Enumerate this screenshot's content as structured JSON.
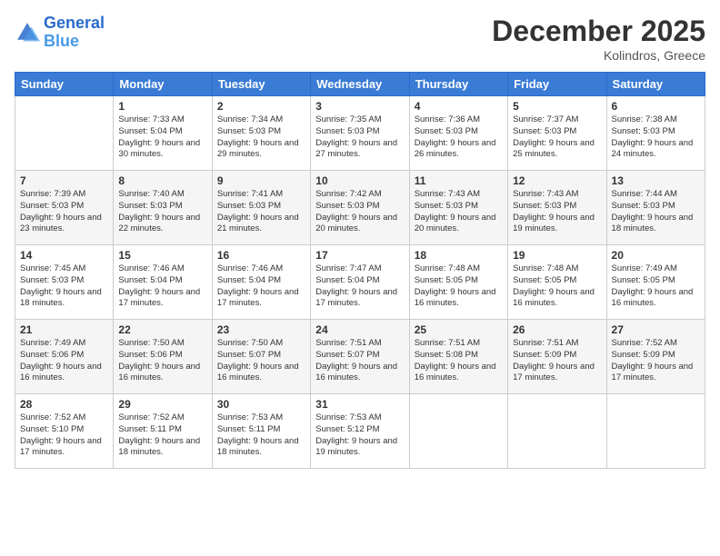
{
  "header": {
    "logo_line1": "General",
    "logo_line2": "Blue",
    "month_title": "December 2025",
    "subtitle": "Kolindros, Greece"
  },
  "weekdays": [
    "Sunday",
    "Monday",
    "Tuesday",
    "Wednesday",
    "Thursday",
    "Friday",
    "Saturday"
  ],
  "weeks": [
    [
      {
        "day": "",
        "sunrise": "",
        "sunset": "",
        "daylight": ""
      },
      {
        "day": "1",
        "sunrise": "Sunrise: 7:33 AM",
        "sunset": "Sunset: 5:04 PM",
        "daylight": "Daylight: 9 hours and 30 minutes."
      },
      {
        "day": "2",
        "sunrise": "Sunrise: 7:34 AM",
        "sunset": "Sunset: 5:03 PM",
        "daylight": "Daylight: 9 hours and 29 minutes."
      },
      {
        "day": "3",
        "sunrise": "Sunrise: 7:35 AM",
        "sunset": "Sunset: 5:03 PM",
        "daylight": "Daylight: 9 hours and 27 minutes."
      },
      {
        "day": "4",
        "sunrise": "Sunrise: 7:36 AM",
        "sunset": "Sunset: 5:03 PM",
        "daylight": "Daylight: 9 hours and 26 minutes."
      },
      {
        "day": "5",
        "sunrise": "Sunrise: 7:37 AM",
        "sunset": "Sunset: 5:03 PM",
        "daylight": "Daylight: 9 hours and 25 minutes."
      },
      {
        "day": "6",
        "sunrise": "Sunrise: 7:38 AM",
        "sunset": "Sunset: 5:03 PM",
        "daylight": "Daylight: 9 hours and 24 minutes."
      }
    ],
    [
      {
        "day": "7",
        "sunrise": "Sunrise: 7:39 AM",
        "sunset": "Sunset: 5:03 PM",
        "daylight": "Daylight: 9 hours and 23 minutes."
      },
      {
        "day": "8",
        "sunrise": "Sunrise: 7:40 AM",
        "sunset": "Sunset: 5:03 PM",
        "daylight": "Daylight: 9 hours and 22 minutes."
      },
      {
        "day": "9",
        "sunrise": "Sunrise: 7:41 AM",
        "sunset": "Sunset: 5:03 PM",
        "daylight": "Daylight: 9 hours and 21 minutes."
      },
      {
        "day": "10",
        "sunrise": "Sunrise: 7:42 AM",
        "sunset": "Sunset: 5:03 PM",
        "daylight": "Daylight: 9 hours and 20 minutes."
      },
      {
        "day": "11",
        "sunrise": "Sunrise: 7:43 AM",
        "sunset": "Sunset: 5:03 PM",
        "daylight": "Daylight: 9 hours and 20 minutes."
      },
      {
        "day": "12",
        "sunrise": "Sunrise: 7:43 AM",
        "sunset": "Sunset: 5:03 PM",
        "daylight": "Daylight: 9 hours and 19 minutes."
      },
      {
        "day": "13",
        "sunrise": "Sunrise: 7:44 AM",
        "sunset": "Sunset: 5:03 PM",
        "daylight": "Daylight: 9 hours and 18 minutes."
      }
    ],
    [
      {
        "day": "14",
        "sunrise": "Sunrise: 7:45 AM",
        "sunset": "Sunset: 5:03 PM",
        "daylight": "Daylight: 9 hours and 18 minutes."
      },
      {
        "day": "15",
        "sunrise": "Sunrise: 7:46 AM",
        "sunset": "Sunset: 5:04 PM",
        "daylight": "Daylight: 9 hours and 17 minutes."
      },
      {
        "day": "16",
        "sunrise": "Sunrise: 7:46 AM",
        "sunset": "Sunset: 5:04 PM",
        "daylight": "Daylight: 9 hours and 17 minutes."
      },
      {
        "day": "17",
        "sunrise": "Sunrise: 7:47 AM",
        "sunset": "Sunset: 5:04 PM",
        "daylight": "Daylight: 9 hours and 17 minutes."
      },
      {
        "day": "18",
        "sunrise": "Sunrise: 7:48 AM",
        "sunset": "Sunset: 5:05 PM",
        "daylight": "Daylight: 9 hours and 16 minutes."
      },
      {
        "day": "19",
        "sunrise": "Sunrise: 7:48 AM",
        "sunset": "Sunset: 5:05 PM",
        "daylight": "Daylight: 9 hours and 16 minutes."
      },
      {
        "day": "20",
        "sunrise": "Sunrise: 7:49 AM",
        "sunset": "Sunset: 5:05 PM",
        "daylight": "Daylight: 9 hours and 16 minutes."
      }
    ],
    [
      {
        "day": "21",
        "sunrise": "Sunrise: 7:49 AM",
        "sunset": "Sunset: 5:06 PM",
        "daylight": "Daylight: 9 hours and 16 minutes."
      },
      {
        "day": "22",
        "sunrise": "Sunrise: 7:50 AM",
        "sunset": "Sunset: 5:06 PM",
        "daylight": "Daylight: 9 hours and 16 minutes."
      },
      {
        "day": "23",
        "sunrise": "Sunrise: 7:50 AM",
        "sunset": "Sunset: 5:07 PM",
        "daylight": "Daylight: 9 hours and 16 minutes."
      },
      {
        "day": "24",
        "sunrise": "Sunrise: 7:51 AM",
        "sunset": "Sunset: 5:07 PM",
        "daylight": "Daylight: 9 hours and 16 minutes."
      },
      {
        "day": "25",
        "sunrise": "Sunrise: 7:51 AM",
        "sunset": "Sunset: 5:08 PM",
        "daylight": "Daylight: 9 hours and 16 minutes."
      },
      {
        "day": "26",
        "sunrise": "Sunrise: 7:51 AM",
        "sunset": "Sunset: 5:09 PM",
        "daylight": "Daylight: 9 hours and 17 minutes."
      },
      {
        "day": "27",
        "sunrise": "Sunrise: 7:52 AM",
        "sunset": "Sunset: 5:09 PM",
        "daylight": "Daylight: 9 hours and 17 minutes."
      }
    ],
    [
      {
        "day": "28",
        "sunrise": "Sunrise: 7:52 AM",
        "sunset": "Sunset: 5:10 PM",
        "daylight": "Daylight: 9 hours and 17 minutes."
      },
      {
        "day": "29",
        "sunrise": "Sunrise: 7:52 AM",
        "sunset": "Sunset: 5:11 PM",
        "daylight": "Daylight: 9 hours and 18 minutes."
      },
      {
        "day": "30",
        "sunrise": "Sunrise: 7:53 AM",
        "sunset": "Sunset: 5:11 PM",
        "daylight": "Daylight: 9 hours and 18 minutes."
      },
      {
        "day": "31",
        "sunrise": "Sunrise: 7:53 AM",
        "sunset": "Sunset: 5:12 PM",
        "daylight": "Daylight: 9 hours and 19 minutes."
      },
      {
        "day": "",
        "sunrise": "",
        "sunset": "",
        "daylight": ""
      },
      {
        "day": "",
        "sunrise": "",
        "sunset": "",
        "daylight": ""
      },
      {
        "day": "",
        "sunrise": "",
        "sunset": "",
        "daylight": ""
      }
    ]
  ]
}
